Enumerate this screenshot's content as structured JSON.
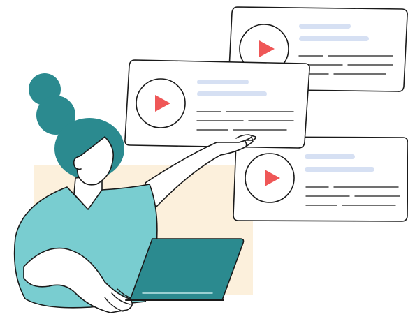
{
  "colors": {
    "background": "#ffffff",
    "backdrop_panel": "#fcf0dc",
    "hair": "#2b8a8f",
    "shirt": "#79cdd0",
    "laptop": "#2b8a8f",
    "play_icon": "#ef5757",
    "placeholder_line": "#d6e0f3",
    "outline": "#1a1a1a"
  },
  "illustration": {
    "subject": "woman-with-laptop",
    "video_cards": [
      {
        "id": "card-top-right",
        "icon": "play-icon"
      },
      {
        "id": "card-front",
        "icon": "play-icon"
      },
      {
        "id": "card-bottom-right",
        "icon": "play-icon"
      }
    ]
  }
}
